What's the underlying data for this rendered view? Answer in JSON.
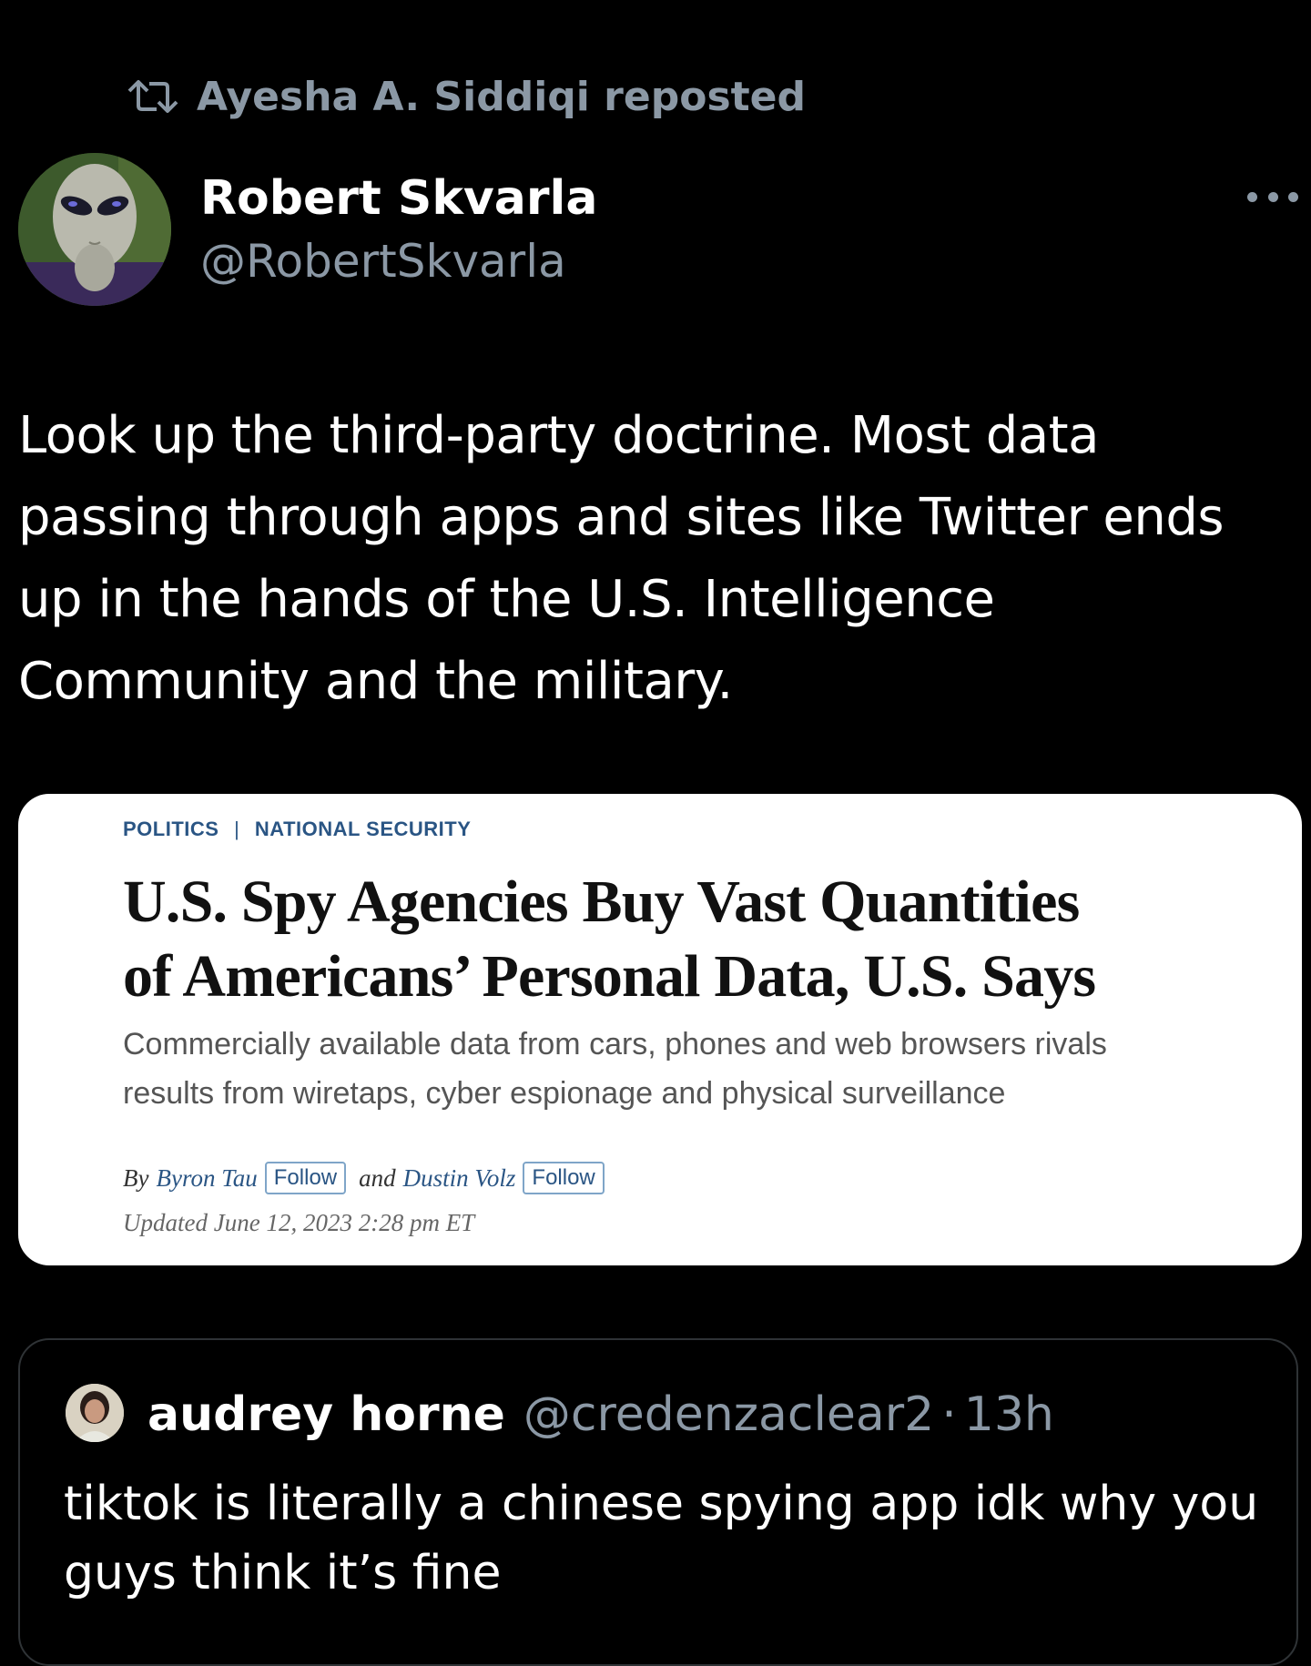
{
  "repost": {
    "icon": "repost-icon",
    "text": "Ayesha A. Siddiqi reposted"
  },
  "tweet": {
    "author_name": "Robert Skvarla",
    "author_handle": "@RobertSkvarla",
    "avatar_icon": "alien-avatar",
    "more_icon": "more-options-icon",
    "text": "Look up the third-party doctrine. Most data\npassing through apps and sites like Twitter ends\nup in the hands of the U.S. Intelligence\nCommunity and the military."
  },
  "article": {
    "kicker_section": "POLITICS",
    "kicker_separator": "|",
    "kicker_subsection": "NATIONAL SECURITY",
    "headline": "U.S. Spy Agencies Buy Vast Quantities\nof Americans’ Personal Data, U.S. Says",
    "dek": "Commercially available data from cars, phones and web browsers rivals\nresults from wiretaps, cyber espionage and physical surveillance",
    "by_label": "By",
    "author_1": "Byron Tau",
    "follow_label": "Follow",
    "and_label": "and",
    "author_2": "Dustin Volz",
    "updated": "Updated June 12, 2023 2:28 pm ET"
  },
  "quote": {
    "author_name": "audrey horne",
    "author_handle": "@credenzaclear2",
    "separator": "·",
    "time": "13h",
    "text": "tiktok is literally a chinese spying app idk why you\nguys think it’s fine"
  },
  "colors": {
    "background": "#000000",
    "secondary_text": "#8b98a5",
    "primary_text": "#ffffff",
    "card_background": "#ffffff",
    "link_blue": "#2a5584"
  }
}
